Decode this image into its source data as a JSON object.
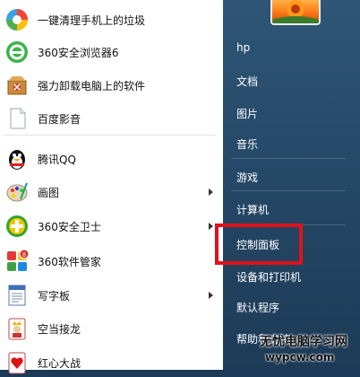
{
  "programs": [
    {
      "label": "一键清理手机上的垃圾",
      "icon": "cleaner-app-icon",
      "submenu": false
    },
    {
      "label": "360安全浏览器6",
      "icon": "360-browser-icon",
      "submenu": false
    },
    {
      "label": "强力卸载电脑上的软件",
      "icon": "uninstall-box-icon",
      "submenu": false
    },
    {
      "label": "百度影音",
      "icon": "blank-document-icon",
      "submenu": false
    },
    {
      "label": "腾讯QQ",
      "icon": "qq-penguin-icon",
      "submenu": false
    },
    {
      "label": "画图",
      "icon": "paint-palette-icon",
      "submenu": true
    },
    {
      "label": "360安全卫士",
      "icon": "360-guard-icon",
      "submenu": true
    },
    {
      "label": "360软件管家",
      "icon": "360-software-manager-icon",
      "submenu": false
    },
    {
      "label": "写字板",
      "icon": "wordpad-icon",
      "submenu": true
    },
    {
      "label": "空当接龙",
      "icon": "freecell-king-card-icon",
      "submenu": false
    },
    {
      "label": "红心大战",
      "icon": "hearts-card-icon",
      "submenu": false
    }
  ],
  "right_items": [
    {
      "label": "hp"
    },
    {
      "label": "文档"
    },
    {
      "label": "图片"
    },
    {
      "label": "音乐"
    },
    {
      "label": "游戏"
    },
    {
      "label": "计算机"
    },
    {
      "label": "控制面板"
    },
    {
      "label": "设备和打印机"
    },
    {
      "label": "默认程序"
    },
    {
      "label": "帮助和支持"
    }
  ],
  "watermark": {
    "line1": "无忧电脑学习网",
    "line2": "wypcw.com"
  },
  "colors": {
    "highlight": "#e0121a",
    "panel": "#264a69"
  }
}
